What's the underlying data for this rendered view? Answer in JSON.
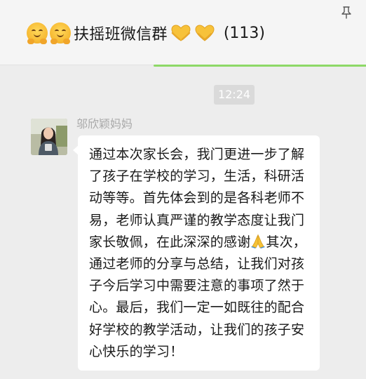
{
  "chat": {
    "title": "扶摇班微信群",
    "member_count": "(113)",
    "title_emojis": [
      "hugging-face",
      "hugging-face",
      "yellow-heart-hands",
      "yellow-heart"
    ]
  },
  "timestamp": "12:24",
  "message": {
    "sender": "邬欣颖妈妈",
    "text_before_emoji": "通过本次家长会，我门更进一步了解了孩子在学校的学习，生活，科研活动等等。首先体会到的是各科老师不易，老师认真严谨的教学态度让我门家长敬佩，在此深深的感谢",
    "text_after_emoji": "其次，通过老师的分享与总结，让我们对孩子今后学习中需要注意的事项了然于心。最后，我们一定一如既往的配合好学校的教学活动，让我们的孩子安心快乐的学习！",
    "inline_emoji": "folded-hands"
  },
  "colors": {
    "header_bg": "#f5f5f5",
    "chat_bg": "#ededed",
    "accent_line": "#8dd867",
    "bubble_bg": "#ffffff",
    "time_badge": "#dadada"
  }
}
